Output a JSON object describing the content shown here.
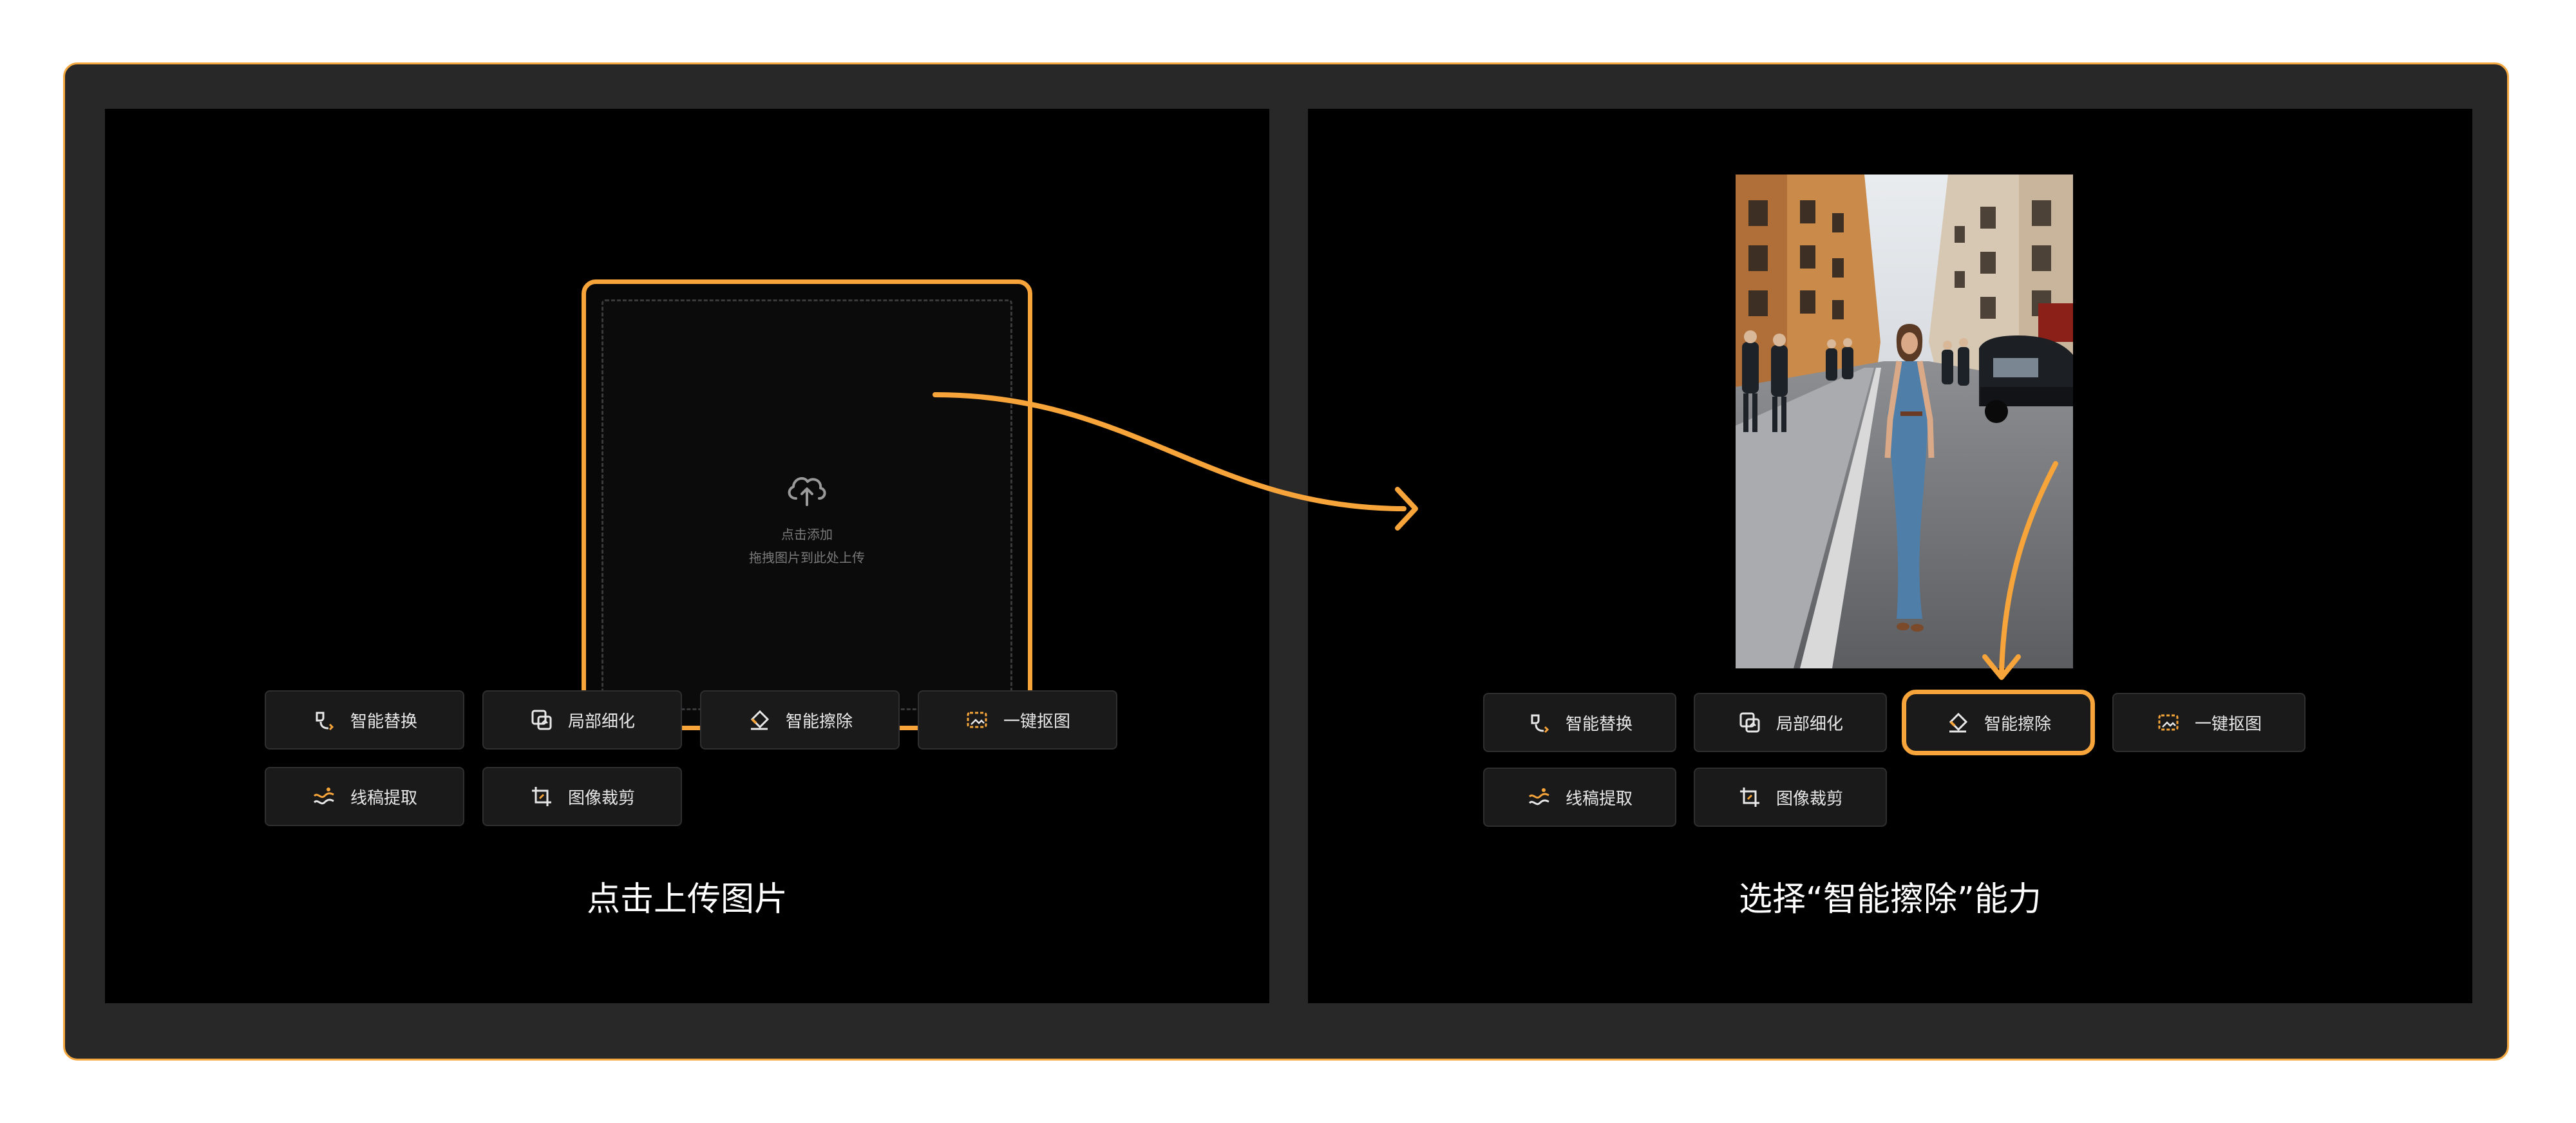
{
  "left_panel": {
    "upload": {
      "line1": "点击添加",
      "line2": "拖拽图片到此处上传"
    },
    "buttons": [
      {
        "label": "智能替换",
        "icon": "smart-replace-icon"
      },
      {
        "label": "局部细化",
        "icon": "local-refine-icon"
      },
      {
        "label": "智能擦除",
        "icon": "smart-erase-icon"
      },
      {
        "label": "一键抠图",
        "icon": "cutout-icon"
      },
      {
        "label": "线稿提取",
        "icon": "lineart-icon"
      },
      {
        "label": "图像裁剪",
        "icon": "crop-icon"
      }
    ],
    "caption": "点击上传图片"
  },
  "right_panel": {
    "buttons": [
      {
        "label": "智能替换",
        "icon": "smart-replace-icon"
      },
      {
        "label": "局部细化",
        "icon": "local-refine-icon"
      },
      {
        "label": "智能擦除",
        "icon": "smart-erase-icon",
        "selected": true
      },
      {
        "label": "一键抠图",
        "icon": "cutout-icon"
      },
      {
        "label": "线稿提取",
        "icon": "lineart-icon"
      },
      {
        "label": "图像裁剪",
        "icon": "crop-icon"
      }
    ],
    "caption": "选择“智能擦除”能力"
  },
  "colors": {
    "accent": "#f7a53a",
    "frame": "#282829",
    "panel": "#000000",
    "button_bg": "#1a1a1b"
  }
}
